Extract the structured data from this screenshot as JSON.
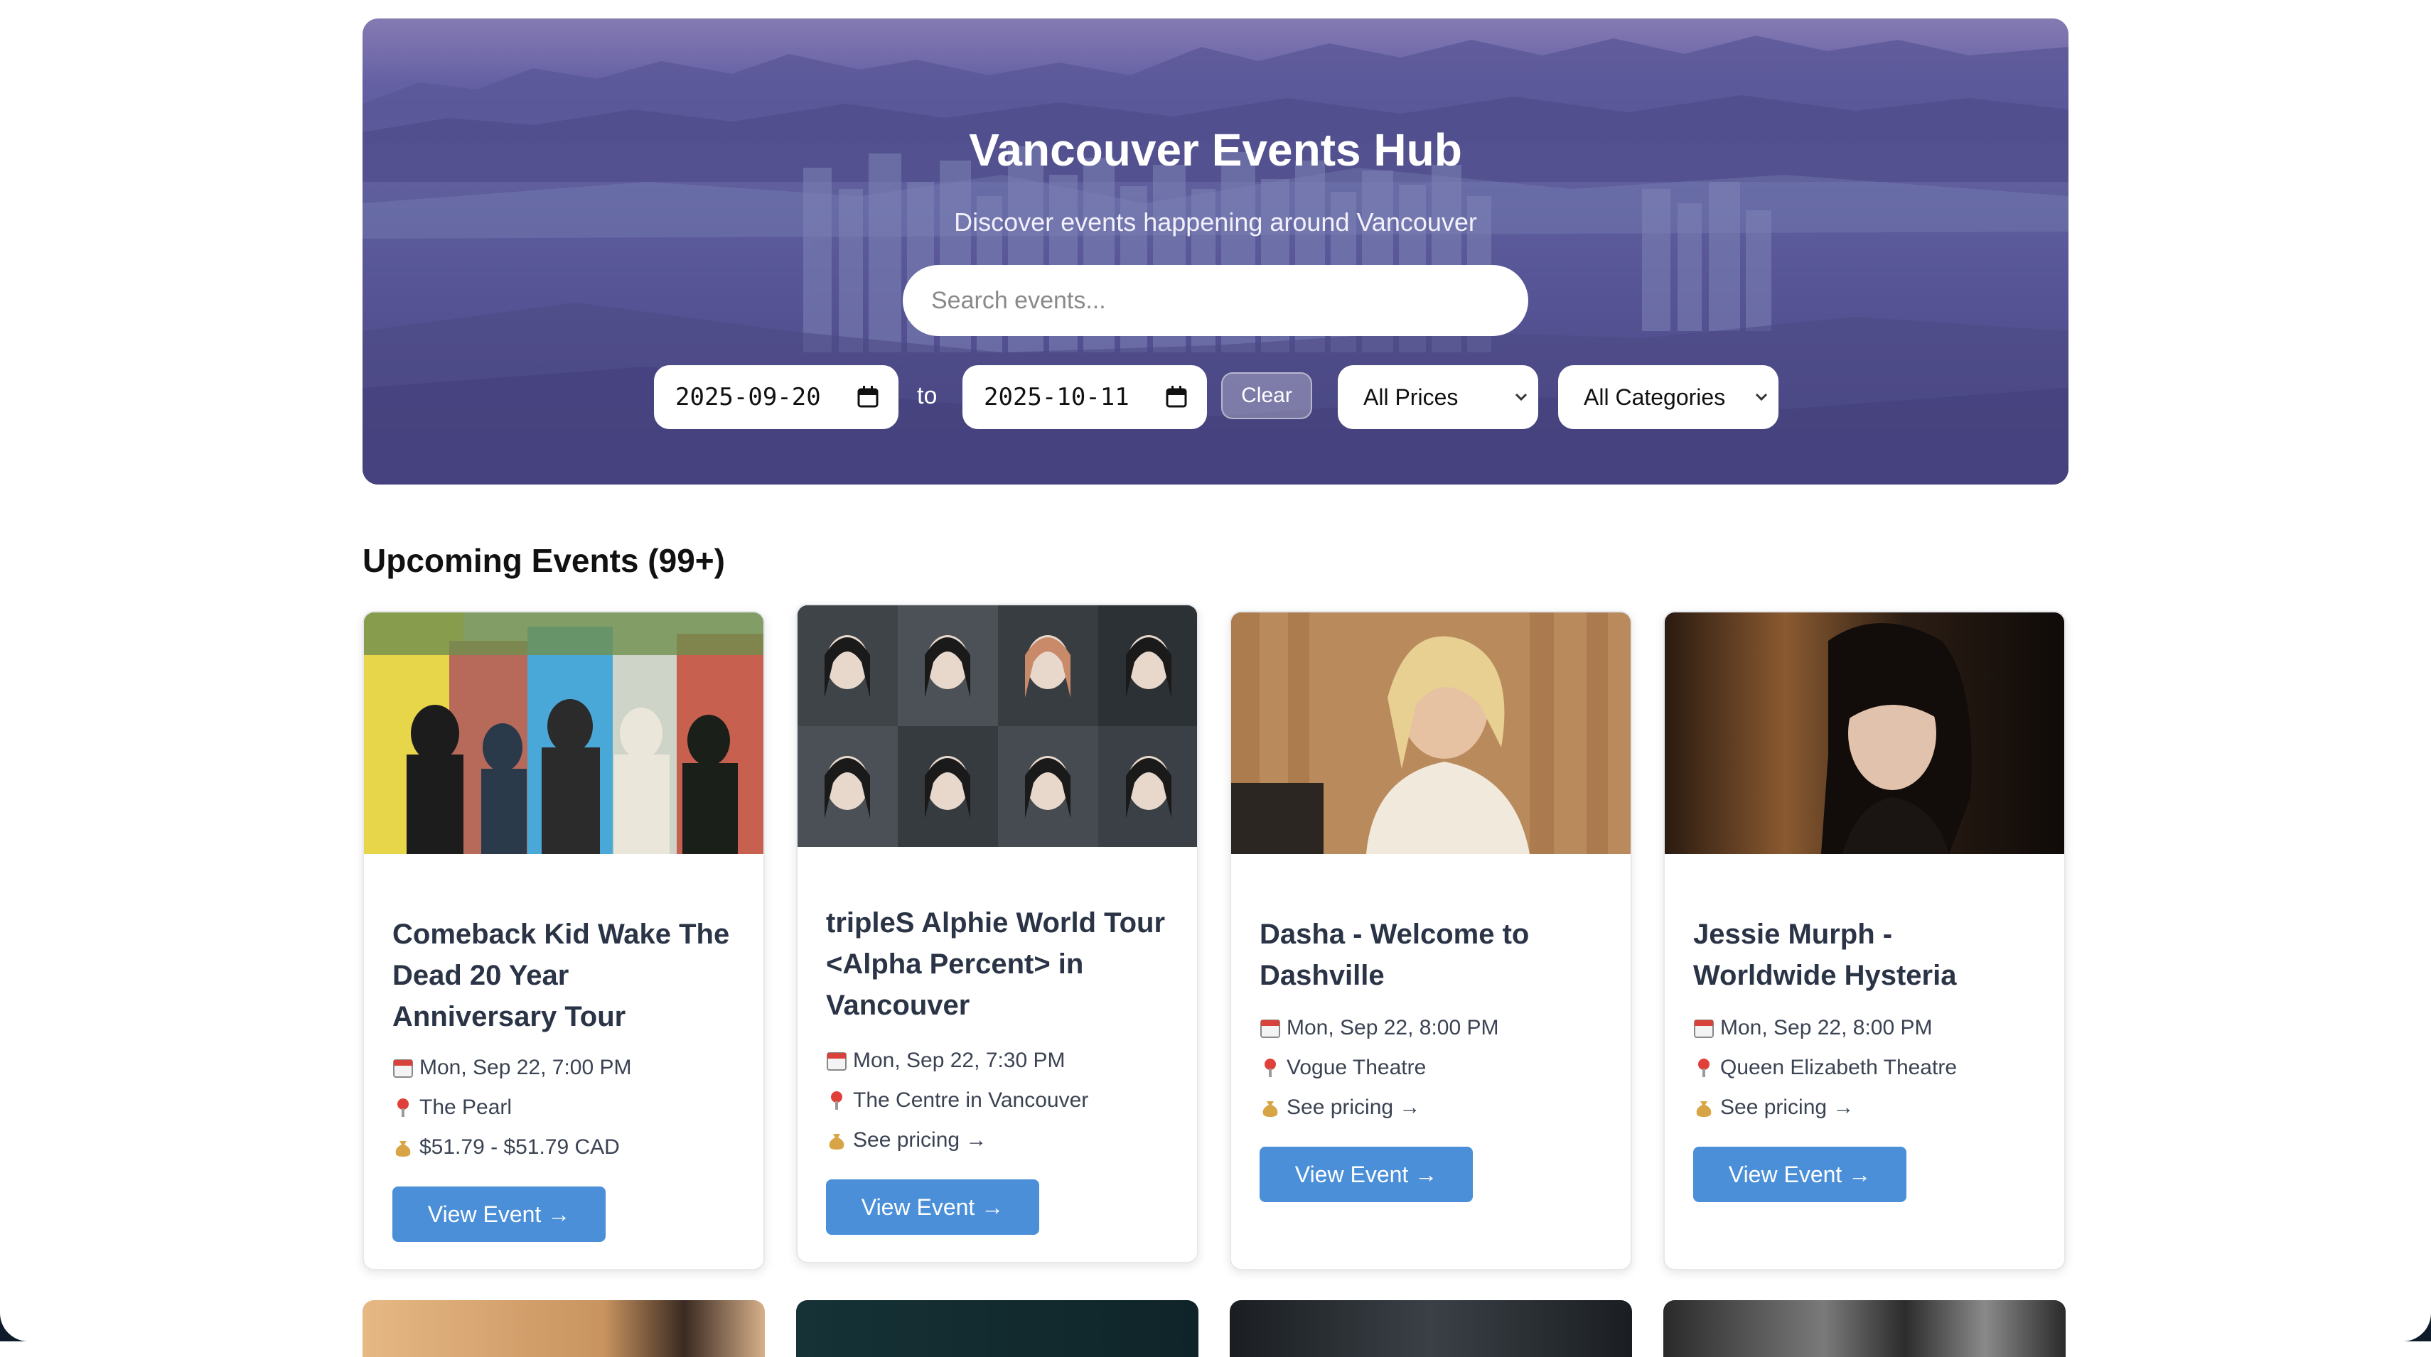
{
  "hero": {
    "title": "Vancouver Events Hub",
    "subtitle": "Discover events happening around Vancouver",
    "search_placeholder": "Search events...",
    "date_from": "2025-09-20",
    "date_to": "2025-10-11",
    "to_label": "to",
    "clear_label": "Clear",
    "price_filter": "All Prices",
    "category_filter": "All Categories"
  },
  "section": {
    "title": "Upcoming Events (99+)"
  },
  "events": [
    {
      "title_lines": [
        "Comeback Kid Wake The",
        "Dead 20 Year",
        "Anniversary Tour"
      ],
      "date": "Mon, Sep 22, 7:00 PM",
      "venue": "The Pearl",
      "price": "$51.79 - $51.79 CAD",
      "button": "View Event →"
    },
    {
      "title_lines": [
        "tripleS Alphie World Tour",
        "<Alpha Percent> in",
        "Vancouver"
      ],
      "date": "Mon, Sep 22, 7:30 PM",
      "venue": "The Centre in Vancouver",
      "price": "See pricing →",
      "button": "View Event →"
    },
    {
      "title_lines": [
        "Dasha - Welcome to",
        "Dashville"
      ],
      "date": "Mon, Sep 22, 8:00 PM",
      "venue": "Vogue Theatre",
      "price": "See pricing →",
      "button": "View Event →"
    },
    {
      "title_lines": [
        "Jessie Murph -",
        "Worldwide Hysteria"
      ],
      "date": "Mon, Sep 22, 8:00 PM",
      "venue": "Queen Elizabeth Theatre",
      "price": "See pricing →",
      "button": "View Event →"
    }
  ],
  "icons": {
    "date": "calendar-icon",
    "venue": "pin-icon",
    "price": "money-bag-icon",
    "dropdown": "chevron-down-icon"
  },
  "colors": {
    "accent": "#4a8fd8",
    "hero_overlay": "#5c54a0",
    "title_text": "#2a3446"
  }
}
